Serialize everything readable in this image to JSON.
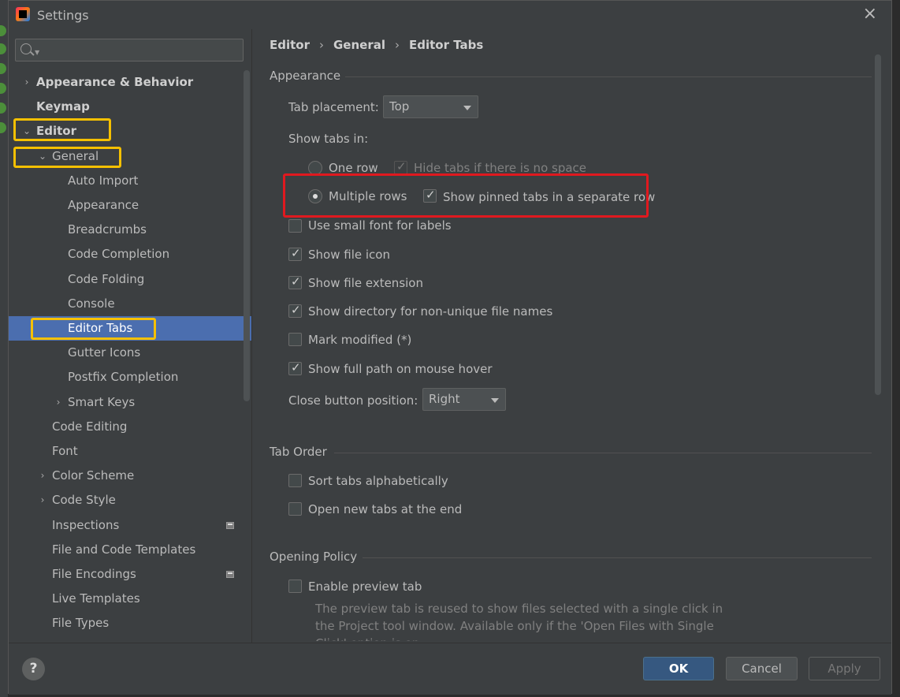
{
  "window": {
    "title": "Settings",
    "close_glyph": "×"
  },
  "search": {
    "placeholder": ""
  },
  "breadcrumb": [
    "Editor",
    "General",
    "Editor Tabs"
  ],
  "tree": [
    {
      "label": "Appearance & Behavior",
      "level": 0,
      "arrow": "›",
      "bold": true
    },
    {
      "label": "Keymap",
      "level": 0,
      "arrow": "",
      "bold": true
    },
    {
      "label": "Editor",
      "level": 0,
      "arrow": "⌄",
      "bold": true
    },
    {
      "label": "General",
      "level": 1,
      "arrow": "⌄"
    },
    {
      "label": "Auto Import",
      "level": 2,
      "arrow": ""
    },
    {
      "label": "Appearance",
      "level": 2,
      "arrow": ""
    },
    {
      "label": "Breadcrumbs",
      "level": 2,
      "arrow": ""
    },
    {
      "label": "Code Completion",
      "level": 2,
      "arrow": ""
    },
    {
      "label": "Code Folding",
      "level": 2,
      "arrow": ""
    },
    {
      "label": "Console",
      "level": 2,
      "arrow": ""
    },
    {
      "label": "Editor Tabs",
      "level": 2,
      "arrow": "",
      "selected": true
    },
    {
      "label": "Gutter Icons",
      "level": 2,
      "arrow": ""
    },
    {
      "label": "Postfix Completion",
      "level": 2,
      "arrow": ""
    },
    {
      "label": "Smart Keys",
      "level": 2,
      "arrow": "›"
    },
    {
      "label": "Code Editing",
      "level": 1,
      "arrow": ""
    },
    {
      "label": "Font",
      "level": 1,
      "arrow": ""
    },
    {
      "label": "Color Scheme",
      "level": 1,
      "arrow": "›"
    },
    {
      "label": "Code Style",
      "level": 1,
      "arrow": "›"
    },
    {
      "label": "Inspections",
      "level": 1,
      "arrow": "",
      "project_icon": true
    },
    {
      "label": "File and Code Templates",
      "level": 1,
      "arrow": ""
    },
    {
      "label": "File Encodings",
      "level": 1,
      "arrow": "",
      "project_icon": true
    },
    {
      "label": "Live Templates",
      "level": 1,
      "arrow": ""
    },
    {
      "label": "File Types",
      "level": 1,
      "arrow": ""
    }
  ],
  "appearance": {
    "section": "Appearance",
    "tab_placement_label": "Tab placement:",
    "tab_placement_value": "Top",
    "show_tabs_in_label": "Show tabs in:",
    "one_row_label": "One row",
    "one_row_selected": false,
    "hide_tabs_label": "Hide tabs if there is no space",
    "hide_tabs_checked": true,
    "multiple_rows_label": "Multiple rows",
    "multiple_rows_selected": true,
    "pinned_label": "Show pinned tabs in a separate row",
    "pinned_checked": true,
    "small_font_label": "Use small font for labels",
    "small_font_checked": false,
    "file_icon_label": "Show file icon",
    "file_icon_checked": true,
    "file_ext_label": "Show file extension",
    "file_ext_checked": true,
    "dir_label": "Show directory for non-unique file names",
    "dir_checked": true,
    "mark_modified_label": "Mark modified (*)",
    "mark_modified_checked": false,
    "full_path_label": "Show full path on mouse hover",
    "full_path_checked": true,
    "close_btn_label": "Close button position:",
    "close_btn_value": "Right"
  },
  "tab_order": {
    "section": "Tab Order",
    "sort_label": "Sort tabs alphabetically",
    "sort_checked": false,
    "open_end_label": "Open new tabs at the end",
    "open_end_checked": false
  },
  "opening_policy": {
    "section": "Opening Policy",
    "preview_label": "Enable preview tab",
    "preview_checked": false,
    "description": "The preview tab is reused to show files selected with a single click in the Project tool window. Available only if the 'Open Files with Single Click' option is on"
  },
  "footer": {
    "help_glyph": "?",
    "ok": "OK",
    "cancel": "Cancel",
    "apply": "Apply"
  },
  "colors": {
    "selection": "#4b6eaf",
    "highlight_yellow": "#f5c000",
    "highlight_red": "#e0191f",
    "ok_button": "#365880"
  }
}
